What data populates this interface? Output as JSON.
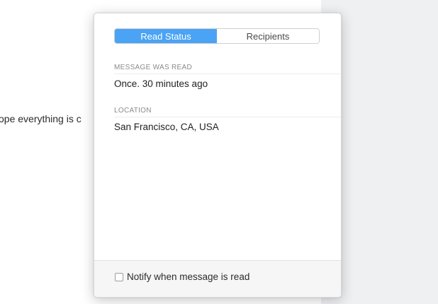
{
  "background": {
    "body_text": "ope everything is c"
  },
  "popover": {
    "tabs": [
      {
        "label": "Read Status",
        "active": true
      },
      {
        "label": "Recipients",
        "active": false
      }
    ],
    "sections": [
      {
        "label": "MESSAGE WAS READ",
        "value": "Once. 30 minutes ago"
      },
      {
        "label": "LOCATION",
        "value": "San Francisco, CA, USA"
      }
    ],
    "footer": {
      "checkbox_label": "Notify when message is read",
      "checked": false
    }
  },
  "colors": {
    "accent": "#4aa3f4",
    "background_panel": "#eff0f2"
  }
}
